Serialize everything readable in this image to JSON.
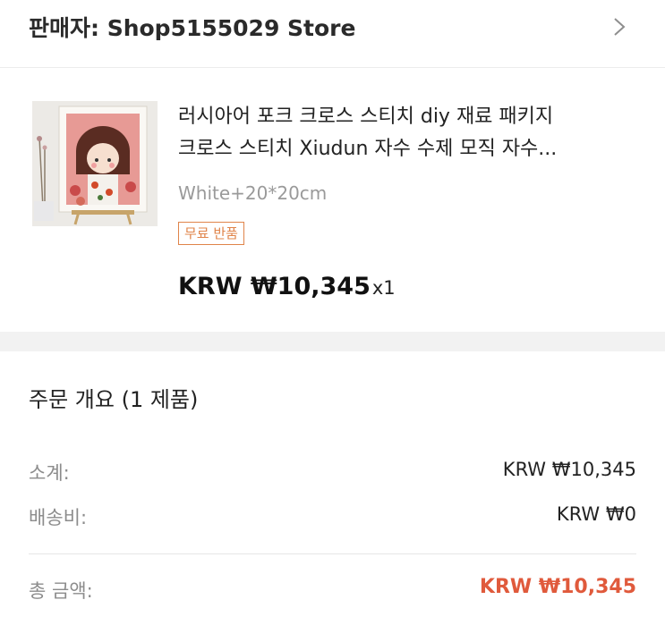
{
  "seller": {
    "name": "판매자: Shop5155029 Store"
  },
  "product": {
    "title_line1": "러시아어 포크 크로스 스티치 diy 재료 패키지",
    "title_line2": "크로스 스티치 Xiudun 자수 수제 모직 자수...",
    "variant": "White+20*20cm",
    "badge": "무료 반품",
    "price": "KRW ₩10,345",
    "quantity": "x1"
  },
  "summary": {
    "title": "주문 개요 (1 제품)",
    "subtotal_label": "소계:",
    "subtotal_value": "KRW ₩10,345",
    "shipping_label": "배송비:",
    "shipping_value": "KRW ₩0",
    "total_label": "총 금액:",
    "total_value": "KRW ₩10,345"
  },
  "colors": {
    "accent": "#e05a3c",
    "badge": "#e0844a",
    "section_gap": "#f2f2f2"
  },
  "icons": {
    "seller_arrow": "chevron-right-icon",
    "product_image": "cross-stitch-girl-thumbnail"
  }
}
